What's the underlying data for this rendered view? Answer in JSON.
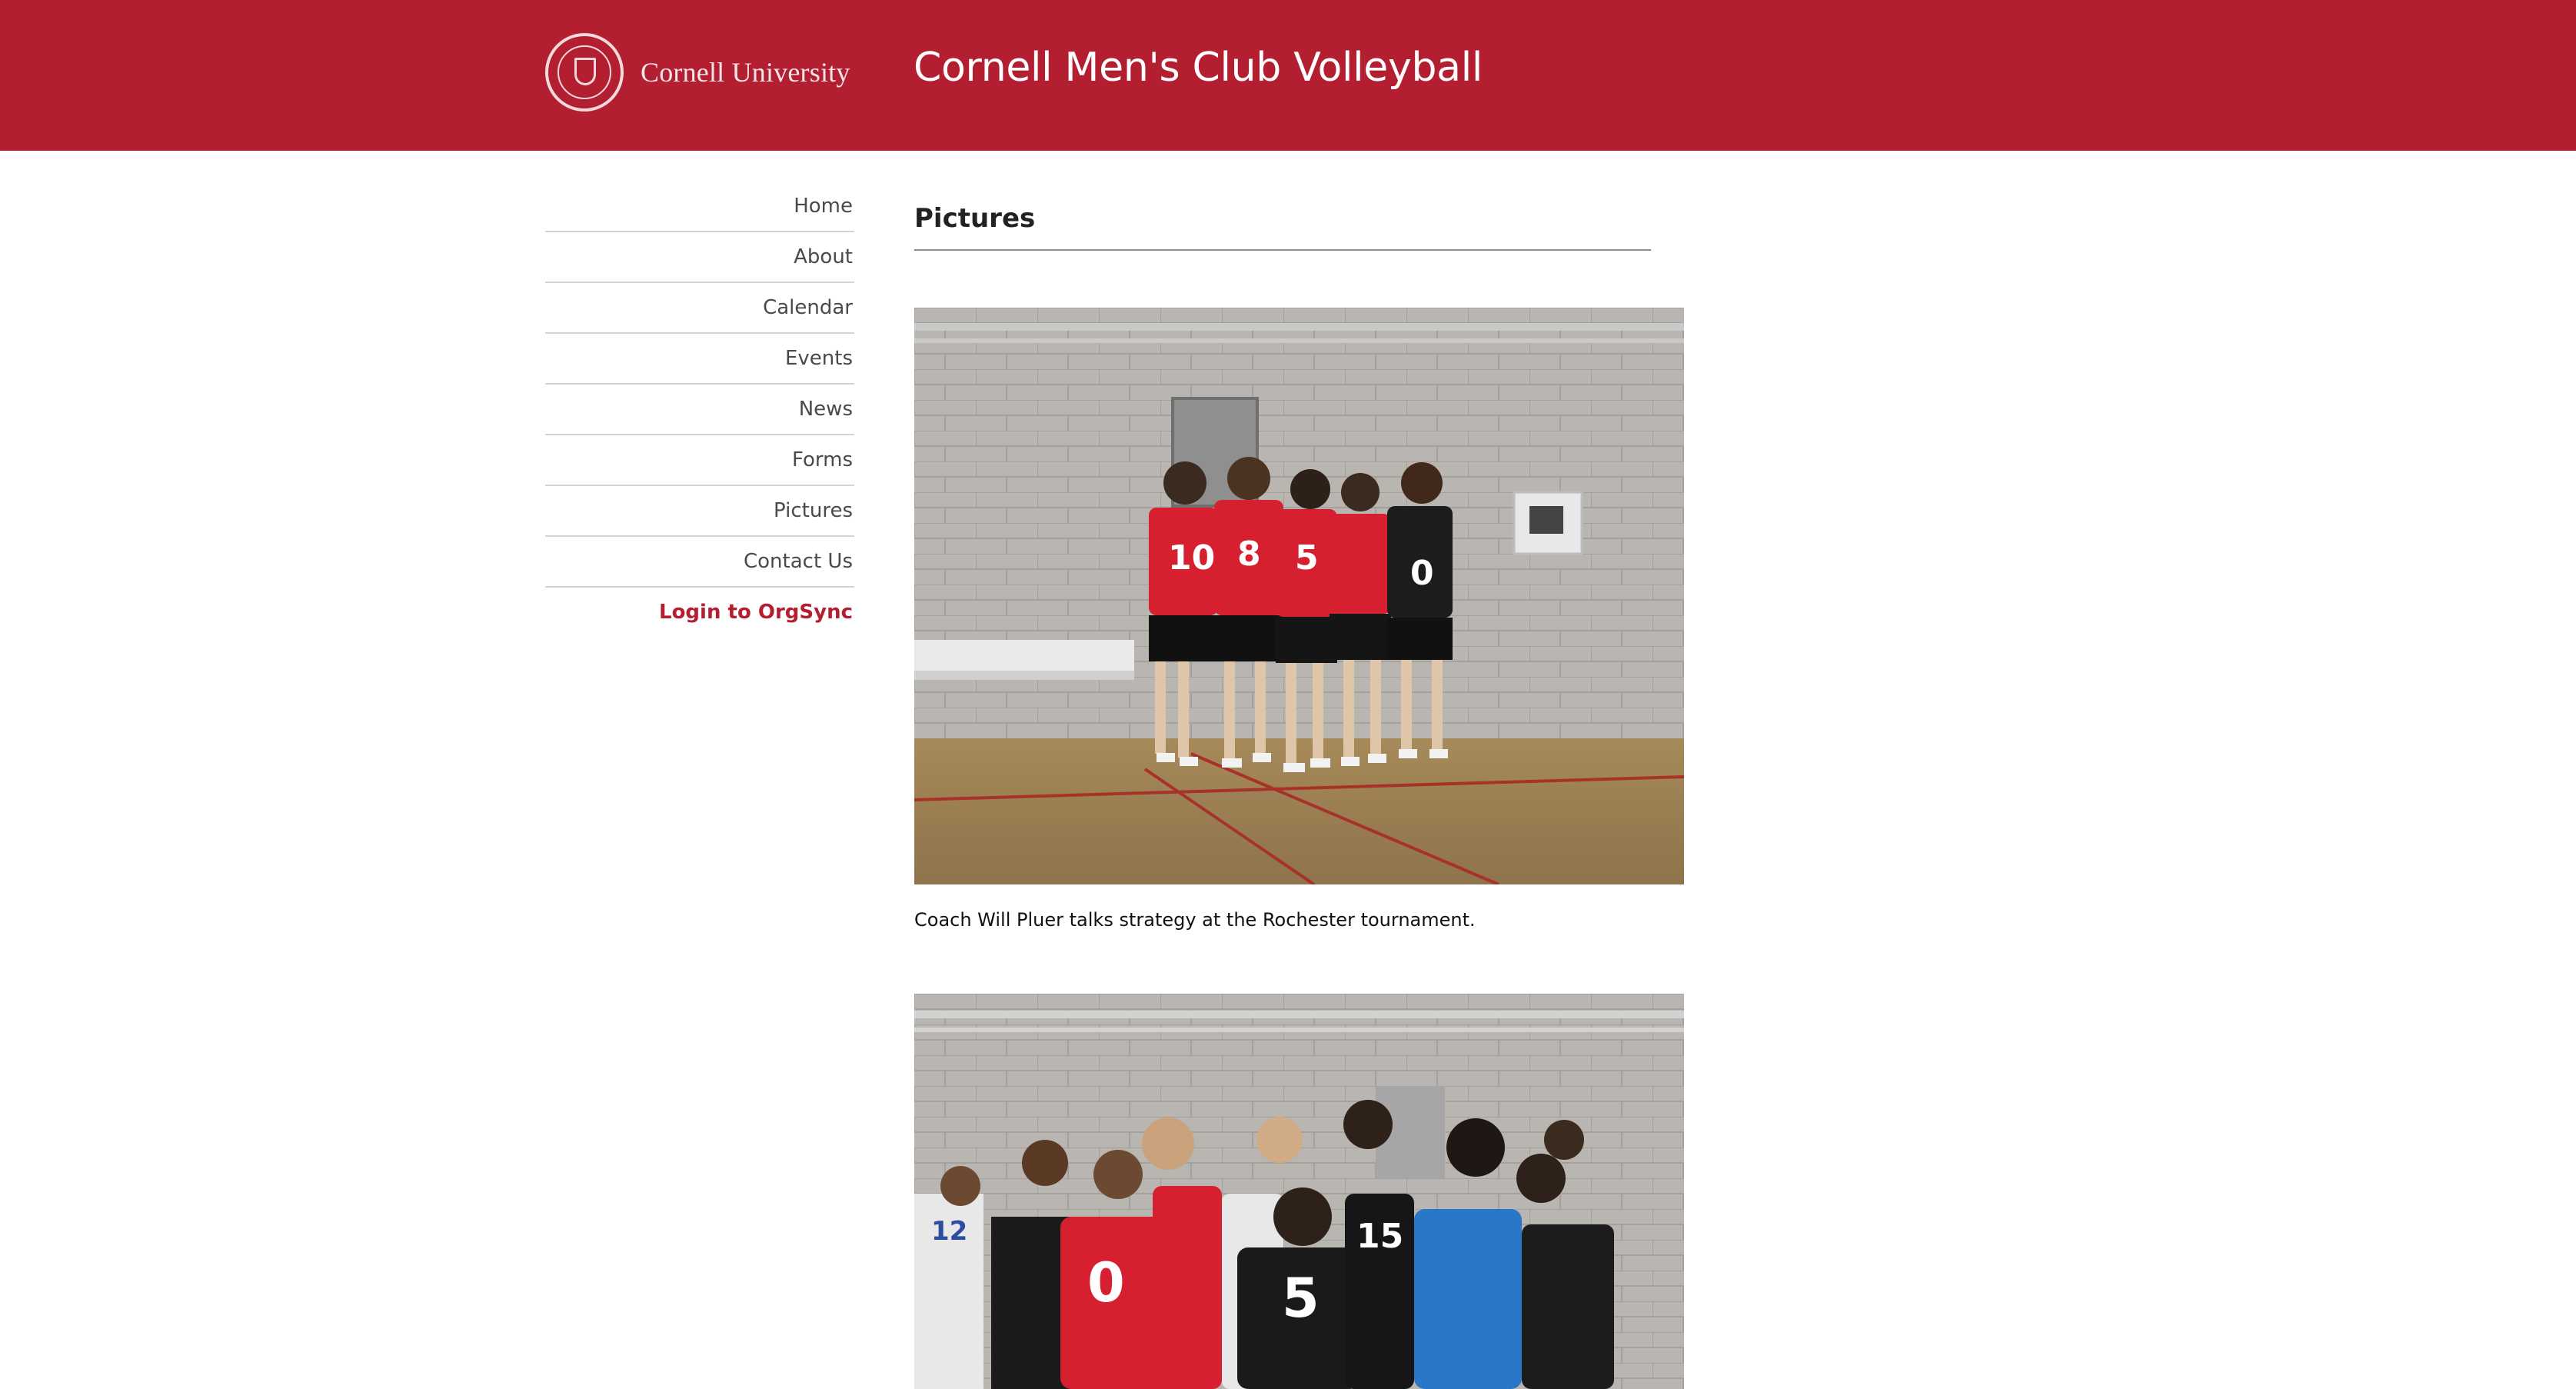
{
  "header": {
    "university_name": "Cornell University",
    "site_title": "Cornell Men's Club Volleyball",
    "accent_color": "#b31f31",
    "logo_icon": "cornell-seal-icon"
  },
  "nav": {
    "items": [
      {
        "label": "Home"
      },
      {
        "label": "About"
      },
      {
        "label": "Calendar"
      },
      {
        "label": "Events"
      },
      {
        "label": "News"
      },
      {
        "label": "Forms"
      },
      {
        "label": "Pictures"
      },
      {
        "label": "Contact Us"
      }
    ],
    "login_label": "Login to OrgSync"
  },
  "main": {
    "heading": "Pictures",
    "photos": [
      {
        "caption": "Coach Will Pluer talks strategy at the Rochester tournament.",
        "jersey_numbers": [
          "10",
          "8",
          "5",
          "0"
        ]
      },
      {
        "caption": "",
        "jersey_numbers": [
          "0",
          "5",
          "15",
          "12"
        ]
      }
    ]
  }
}
